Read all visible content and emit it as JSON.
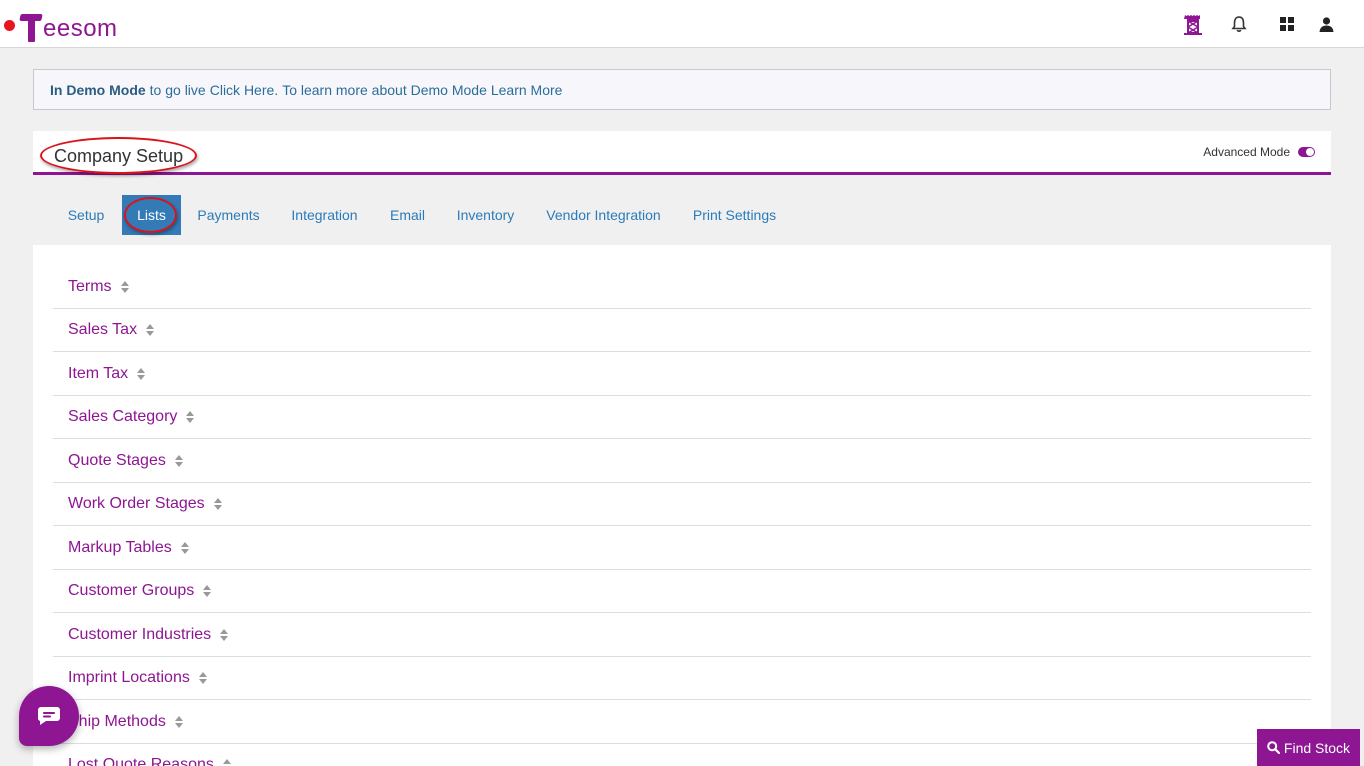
{
  "header": {
    "logo_text": "eesom",
    "icons": [
      "tower-icon",
      "bell-icon",
      "apps-grid-icon",
      "user-icon"
    ]
  },
  "demo_banner": {
    "bold": "In Demo Mode",
    "text1": "to go live",
    "link1": "Click Here.",
    "text2": "To learn more about Demo Mode",
    "link2": "Learn More"
  },
  "setup": {
    "title": "Company Setup",
    "advanced_mode_label": "Advanced Mode",
    "advanced_mode_on": true
  },
  "tabs": [
    {
      "label": "Setup",
      "active": false
    },
    {
      "label": "Lists",
      "active": true
    },
    {
      "label": "Payments",
      "active": false
    },
    {
      "label": "Integration",
      "active": false
    },
    {
      "label": "Email",
      "active": false
    },
    {
      "label": "Inventory",
      "active": false
    },
    {
      "label": "Vendor Integration",
      "active": false
    },
    {
      "label": "Print Settings",
      "active": false
    }
  ],
  "lists": [
    {
      "label": "Terms"
    },
    {
      "label": "Sales Tax"
    },
    {
      "label": "Item Tax"
    },
    {
      "label": "Sales Category"
    },
    {
      "label": "Quote Stages"
    },
    {
      "label": "Work Order Stages"
    },
    {
      "label": "Markup Tables"
    },
    {
      "label": "Customer Groups"
    },
    {
      "label": "Customer Industries"
    },
    {
      "label": "Imprint Locations"
    },
    {
      "label": "Ship Methods"
    },
    {
      "label": "Lost Quote Reasons"
    }
  ],
  "find_stock_label": "Find Stock",
  "colors": {
    "brand": "#8e1693",
    "link": "#2b7bb9",
    "active_tab": "#337ab7",
    "annotation": "#d8141a"
  }
}
